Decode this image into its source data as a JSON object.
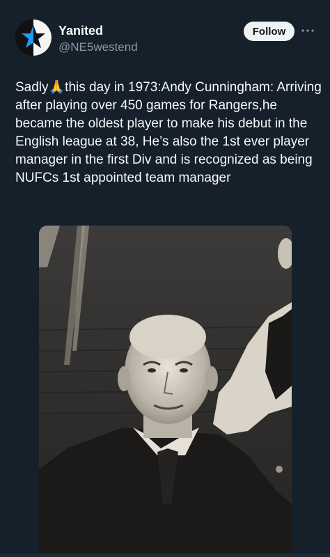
{
  "tweet": {
    "author": {
      "display_name": "Yanited",
      "handle": "@NE5westend",
      "avatar_icon": "star-avatar-icon"
    },
    "follow_label": "Follow",
    "more_icon": "more-options-icon",
    "text": "Sadly🙏this day in 1973:Andy Cunningham: Arriving after playing over 450 games for Rangers,he became the oldest player to make his debut in the English league at 38, He’s also the 1st ever player manager in the first Div and is recognized as being NUFCs 1st appointed team manager",
    "media": {
      "type": "photo",
      "style": "sepia vintage portrait"
    }
  },
  "colors": {
    "background": "#15202b",
    "text_primary": "#f7f9f9",
    "text_secondary": "#8b98a5",
    "follow_button_bg": "#eff3f4",
    "follow_button_text": "#0f1419",
    "avatar_star": "#1d9bf0"
  }
}
